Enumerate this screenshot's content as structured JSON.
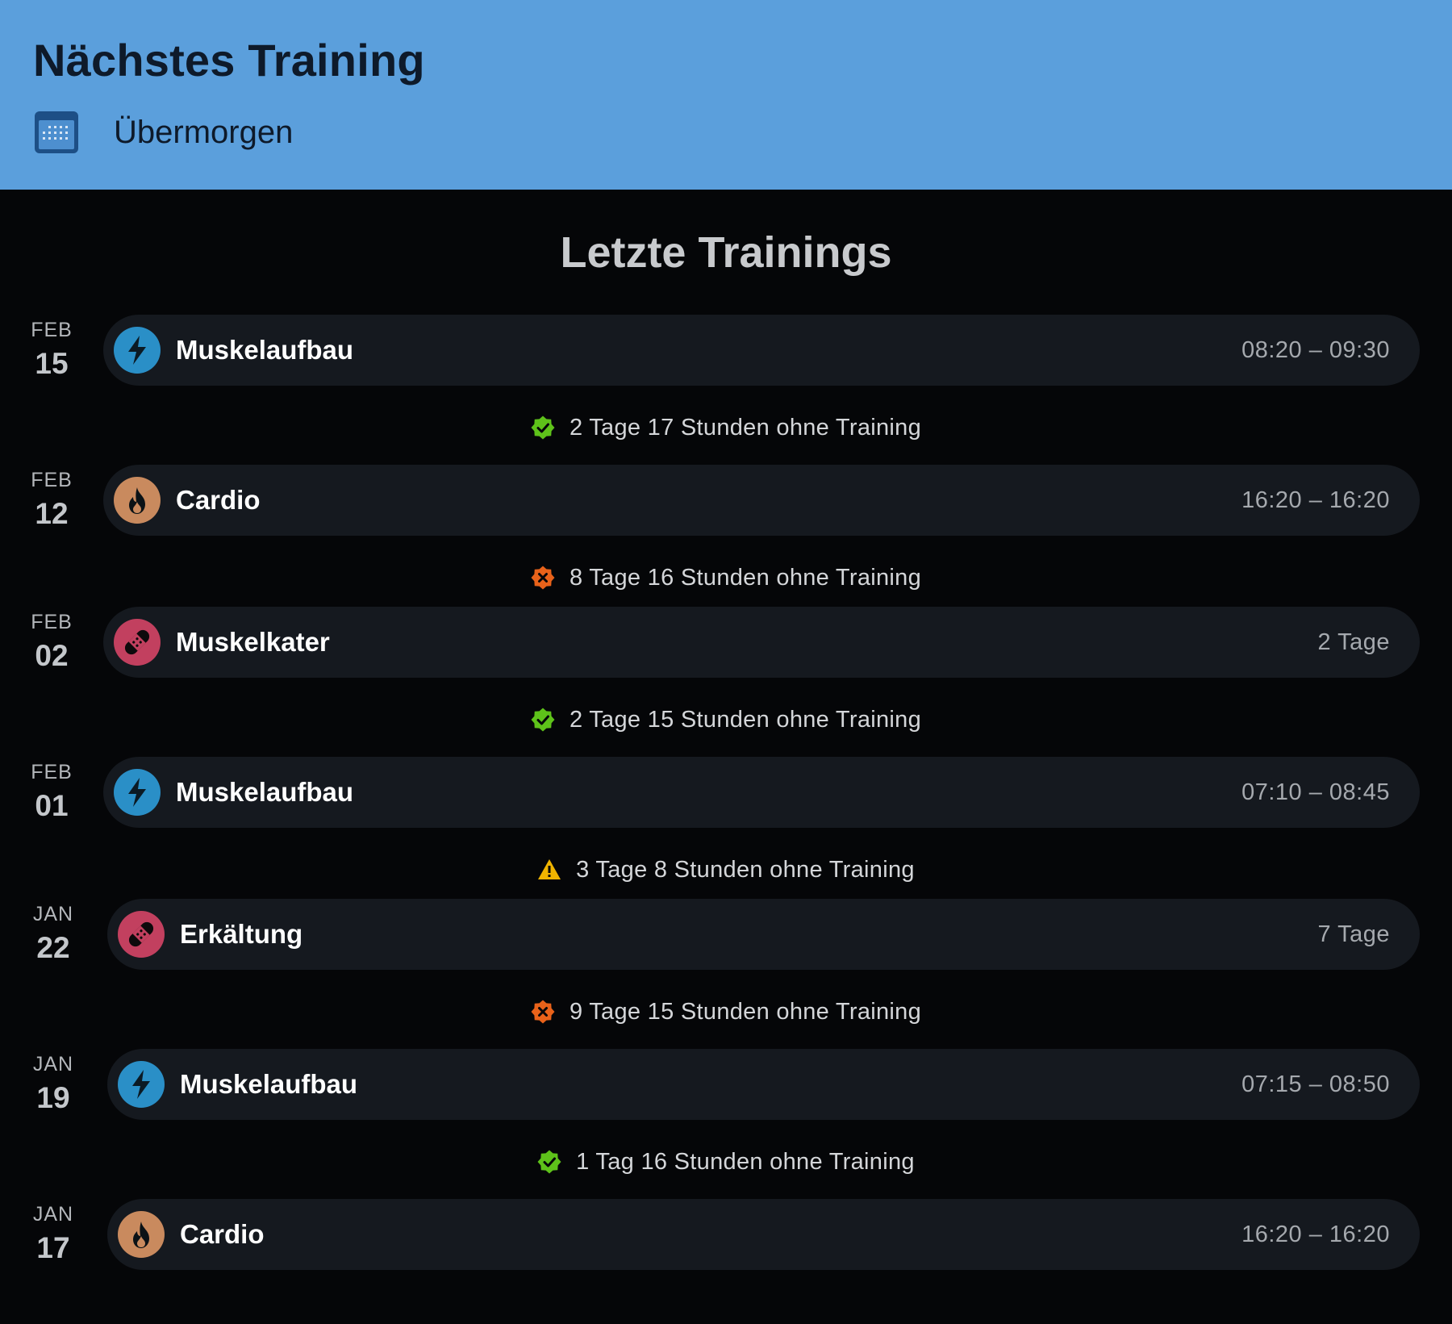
{
  "next_training": {
    "title": "Nächstes Training",
    "when": "Übermorgen",
    "icon": "calendar-icon"
  },
  "history": {
    "title": "Letzte Trainings",
    "entries": [
      {
        "month": "FEB",
        "day": "15",
        "name": "Muskelaufbau",
        "value": "08:20 – 09:30",
        "icon": "lightning-icon",
        "color": "#2a8fc7"
      },
      {
        "month": "FEB",
        "day": "12",
        "name": "Cardio",
        "value": "16:20 – 16:20",
        "icon": "fire-icon",
        "color": "#c98a5e"
      },
      {
        "month": "FEB",
        "day": "02",
        "name": "Muskelkater",
        "value": "2 Tage",
        "icon": "bandage-icon",
        "color": "#c2405f"
      },
      {
        "month": "FEB",
        "day": "01",
        "name": "Muskelaufbau",
        "value": "07:10 – 08:45",
        "icon": "lightning-icon",
        "color": "#2a8fc7"
      },
      {
        "month": "JAN",
        "day": "22",
        "name": "Erkältung",
        "value": "7 Tage",
        "icon": "bandage-icon",
        "color": "#c2405f"
      },
      {
        "month": "JAN",
        "day": "19",
        "name": "Muskelaufbau",
        "value": "07:15 – 08:50",
        "icon": "lightning-icon",
        "color": "#2a8fc7"
      },
      {
        "month": "JAN",
        "day": "17",
        "name": "Cardio",
        "value": "16:20 – 16:20",
        "icon": "fire-icon",
        "color": "#c98a5e"
      }
    ],
    "gaps": [
      {
        "text": "2 Tage 17 Stunden ohne Training",
        "status": "check-badge-icon",
        "color": "#5ec21a"
      },
      {
        "text": "8 Tage 16 Stunden ohne Training",
        "status": "x-badge-icon",
        "color": "#e8621a"
      },
      {
        "text": "2 Tage 15 Stunden ohne Training",
        "status": "check-badge-icon",
        "color": "#5ec21a"
      },
      {
        "text": "3 Tage 8 Stunden ohne Training",
        "status": "warning-icon",
        "color": "#f0b400"
      },
      {
        "text": "9 Tage 15 Stunden ohne Training",
        "status": "x-badge-icon",
        "color": "#e8621a"
      },
      {
        "text": "1 Tag 16 Stunden ohne Training",
        "status": "check-badge-icon",
        "color": "#5ec21a"
      }
    ]
  }
}
